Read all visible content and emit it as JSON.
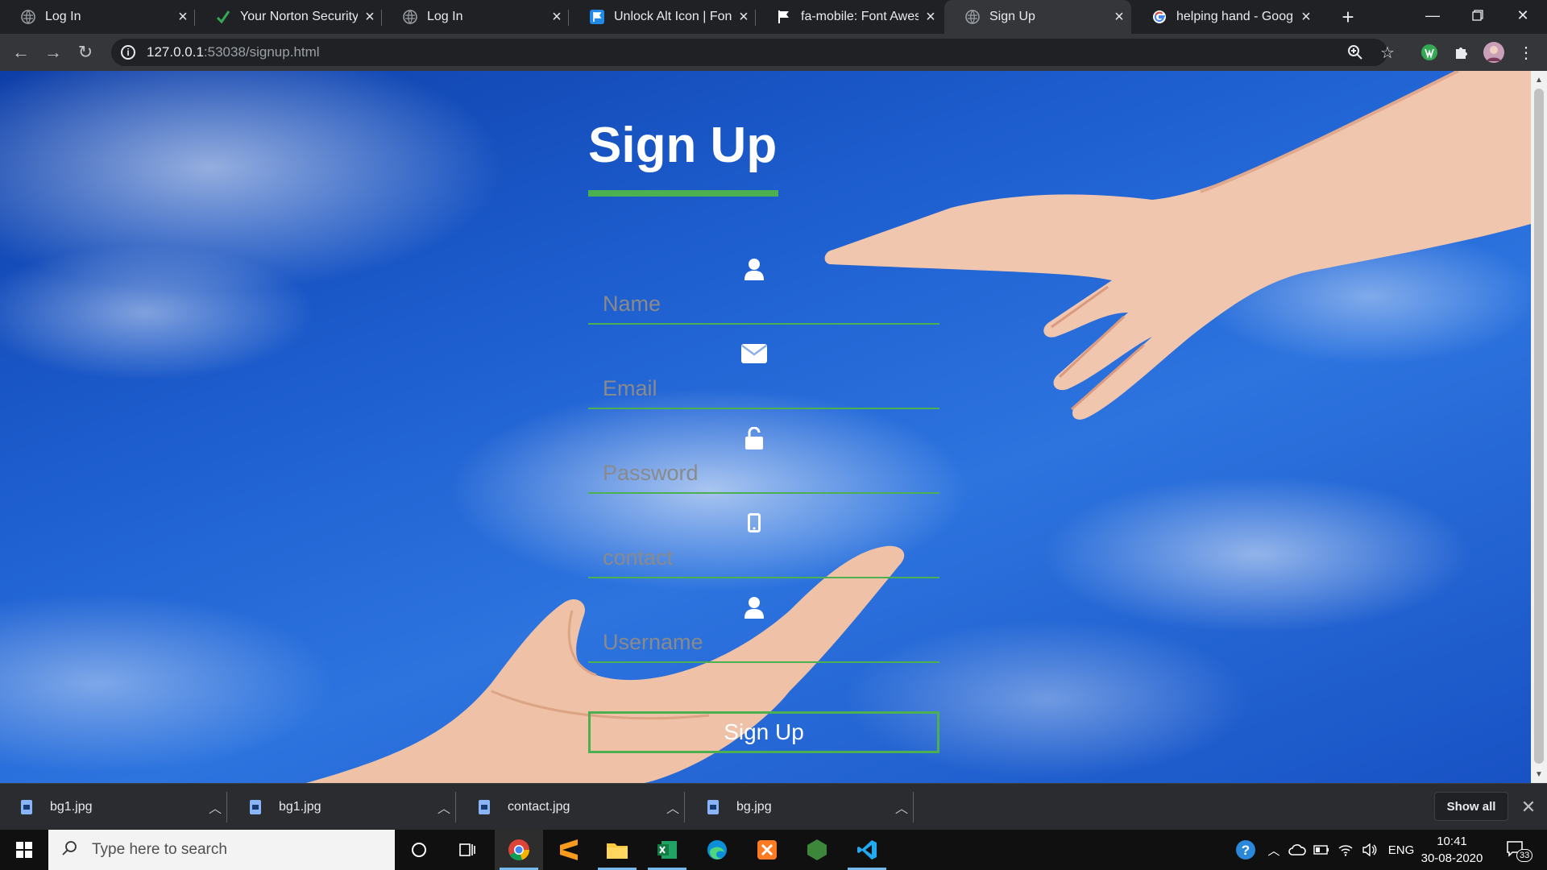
{
  "browser": {
    "tabs": [
      {
        "title": "Log In",
        "icon": "globe-icon",
        "active": false
      },
      {
        "title": "Your Norton Security Li",
        "icon": "checkmark-icon",
        "active": false
      },
      {
        "title": "Log In",
        "icon": "globe-icon",
        "active": false
      },
      {
        "title": "Unlock Alt Icon | Font A",
        "icon": "flag-blue-icon",
        "active": false
      },
      {
        "title": "fa-mobile: Font Aweso",
        "icon": "flag-icon",
        "active": false
      },
      {
        "title": "Sign Up",
        "icon": "globe-icon",
        "active": true
      },
      {
        "title": "helping hand - Google",
        "icon": "google-icon",
        "active": false
      }
    ],
    "address": {
      "host": "127.0.0.1",
      "path": ":53038/signup.html"
    }
  },
  "page": {
    "title": "Sign Up",
    "fields": [
      {
        "placeholder": "Name",
        "icon": "user-icon"
      },
      {
        "placeholder": "Email",
        "icon": "envelope-icon"
      },
      {
        "placeholder": "Password",
        "icon": "unlock-icon"
      },
      {
        "placeholder": "contact",
        "icon": "mobile-icon"
      },
      {
        "placeholder": "Username",
        "icon": "user-icon"
      }
    ],
    "submit_label": "Sign Up",
    "accent_color": "#4caf50"
  },
  "downloads": {
    "items": [
      "bg1.jpg",
      "bg1.jpg",
      "contact.jpg",
      "bg.jpg"
    ],
    "show_all_label": "Show all"
  },
  "taskbar": {
    "search_placeholder": "Type here to search",
    "language": "ENG",
    "time": "10:41",
    "date": "30-08-2020",
    "notification_count": "33"
  }
}
